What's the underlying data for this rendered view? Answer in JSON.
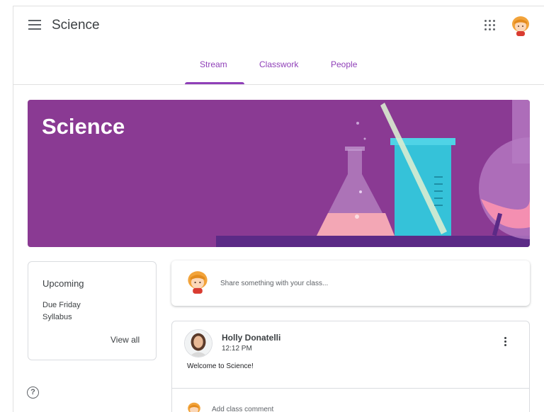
{
  "header": {
    "class_title": "Science",
    "menu_icon": "hamburger-menu-icon",
    "apps_icon": "apps-grid-icon"
  },
  "tabs": [
    {
      "label": "Stream",
      "selected": true
    },
    {
      "label": "Classwork",
      "selected": false
    },
    {
      "label": "People",
      "selected": false
    }
  ],
  "banner": {
    "title": "Science",
    "color": "#8a3a93"
  },
  "upcoming": {
    "title": "Upcoming",
    "due_text": "Due Friday",
    "item": "Syllabus",
    "view_all": "View all"
  },
  "share": {
    "placeholder": "Share something with your class..."
  },
  "post": {
    "author": "Holly Donatelli",
    "time": "12:12 PM",
    "body": "Welcome to Science!",
    "comment_placeholder": "Add class comment"
  },
  "colors": {
    "accent": "#8f3fb8",
    "text": "#3c4043"
  }
}
